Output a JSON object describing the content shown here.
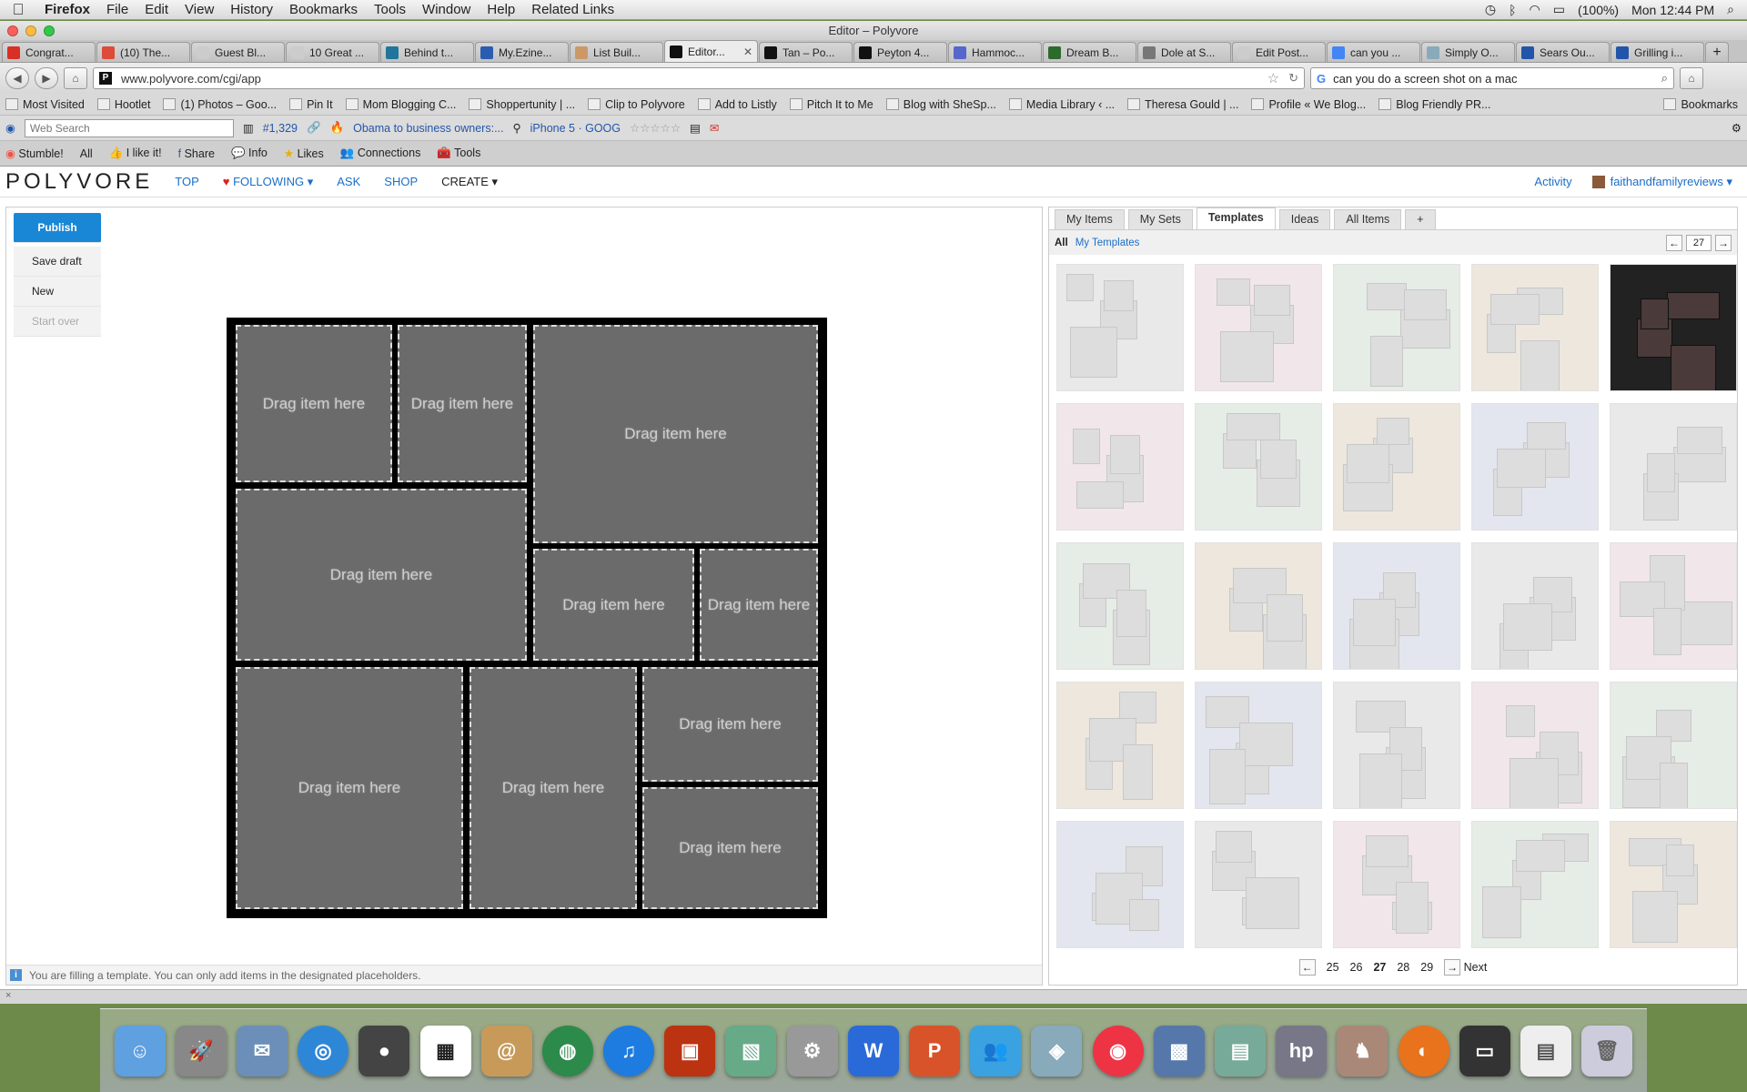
{
  "menubar": {
    "app": "Firefox",
    "items": [
      "File",
      "Edit",
      "View",
      "History",
      "Bookmarks",
      "Tools",
      "Window",
      "Help",
      "Related Links"
    ],
    "battery": "(100%)",
    "clock": "Mon 12:44 PM"
  },
  "window": {
    "title": "Editor – Polyvore"
  },
  "tabs": [
    {
      "label": "Congrat...",
      "icon": "gmail-icon",
      "color": "#d93025"
    },
    {
      "label": "(10) The...",
      "icon": "google-plus-icon",
      "color": "#dd4b39"
    },
    {
      "label": "Guest Bl...",
      "icon": "blank-page-icon",
      "color": "#cccccc"
    },
    {
      "label": "10 Great ...",
      "icon": "blank-page-icon",
      "color": "#cccccc"
    },
    {
      "label": "Behind t...",
      "icon": "wordpress-icon",
      "color": "#21759b"
    },
    {
      "label": "My.Ezine...",
      "icon": "ezine-icon",
      "color": "#2a5db0"
    },
    {
      "label": "List Buil...",
      "icon": "list-icon",
      "color": "#c96"
    },
    {
      "label": "Editor...",
      "icon": "polyvore-icon",
      "color": "#111111",
      "active": true
    },
    {
      "label": "Tan – Po...",
      "icon": "polyvore-icon",
      "color": "#111111"
    },
    {
      "label": "Peyton 4...",
      "icon": "polyvore-icon",
      "color": "#111111"
    },
    {
      "label": "Hammoc...",
      "icon": "site-icon",
      "color": "#5566cc"
    },
    {
      "label": "Dream B...",
      "icon": "site-icon",
      "color": "#2d6a2d"
    },
    {
      "label": "Dole at S...",
      "icon": "site-icon",
      "color": "#777777"
    },
    {
      "label": "Edit Post...",
      "icon": "blank-page-icon",
      "color": "#cccccc"
    },
    {
      "label": "can you ...",
      "icon": "google-icon",
      "color": "#4285f4"
    },
    {
      "label": "Simply O...",
      "icon": "cloud-icon",
      "color": "#8ab"
    },
    {
      "label": "Sears Ou...",
      "icon": "sears-icon",
      "color": "#2255aa"
    },
    {
      "label": "Grilling i...",
      "icon": "sears-icon",
      "color": "#2255aa"
    }
  ],
  "nav": {
    "url": "www.polyvore.com/cgi/app",
    "search": "can you do a screen shot on a mac"
  },
  "bookmarks": [
    "Most Visited",
    "Hootlet",
    "(1) Photos – Goo...",
    "Pin It",
    "Mom Blogging C...",
    "Shoppertunity | ...",
    "Clip to Polyvore",
    "Add to Listly",
    "Pitch It to Me",
    "Blog with SheSp...",
    "Media Library ‹ ...",
    "Theresa Gould | ...",
    "Profile « We Blog...",
    "Blog Friendly PR...",
    "Bookmarks"
  ],
  "toolbar1": {
    "search_placeholder": "Web Search",
    "rank": "#1,329",
    "news": "Obama to business owners:...",
    "stock": "iPhone 5 · GOOG"
  },
  "toolbar2": [
    "Stumble!",
    "All",
    "I like it!",
    "Share",
    "Info",
    "Likes",
    "Connections",
    "Tools"
  ],
  "polyvore": {
    "logo": "POLYVORE",
    "nav": [
      "TOP",
      "FOLLOWING",
      "ASK",
      "SHOP",
      "CREATE"
    ],
    "activity": "Activity",
    "user": "faithandfamilyreviews"
  },
  "editor": {
    "buttons": [
      "Publish",
      "Save draft",
      "New",
      "Start over"
    ],
    "slot_text": "Drag item here",
    "info": "You are filling a template. You can only add items in the designated placeholders."
  },
  "panel": {
    "tabs": [
      "My Items",
      "My Sets",
      "Templates",
      "Ideas",
      "All Items",
      "+"
    ],
    "active_tab": "Templates",
    "filter_all": "All",
    "filter_mine": "My Templates",
    "page": "27",
    "pager": [
      "25",
      "26",
      "27",
      "28",
      "29"
    ],
    "next": "Next"
  },
  "status": "×"
}
